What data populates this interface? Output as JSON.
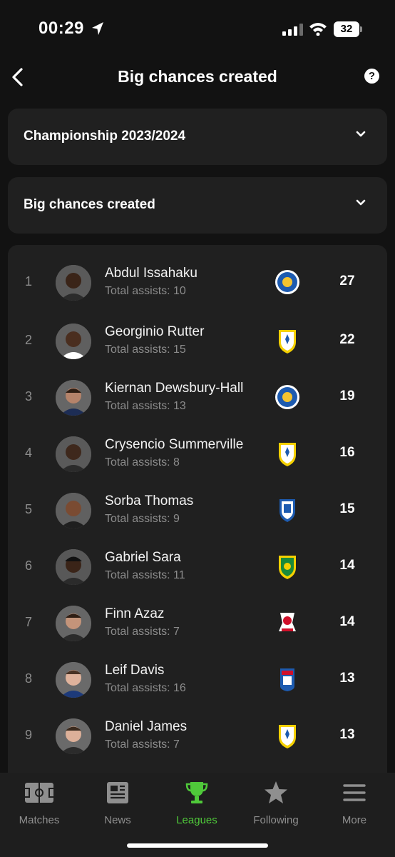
{
  "status_bar": {
    "time": "00:29",
    "battery": "32"
  },
  "header": {
    "title": "Big chances created",
    "help_label": "?"
  },
  "filters": {
    "season": "Championship 2023/2024",
    "stat": "Big chances created"
  },
  "players": [
    {
      "rank": "1",
      "name": "Abdul Issahaku",
      "assists": "Total assists: 10",
      "value": "27",
      "club": "leicester-crest-icon"
    },
    {
      "rank": "2",
      "name": "Georginio Rutter",
      "assists": "Total assists: 15",
      "value": "22",
      "club": "leeds-crest-icon"
    },
    {
      "rank": "3",
      "name": "Kiernan Dewsbury-Hall",
      "assists": "Total assists: 13",
      "value": "19",
      "club": "leicester-crest-icon"
    },
    {
      "rank": "4",
      "name": "Crysencio Summerville",
      "assists": "Total assists: 8",
      "value": "16",
      "club": "leeds-crest-icon"
    },
    {
      "rank": "5",
      "name": "Sorba Thomas",
      "assists": "Total assists: 9",
      "value": "15",
      "club": "huddersfield-crest-icon"
    },
    {
      "rank": "6",
      "name": "Gabriel Sara",
      "assists": "Total assists: 11",
      "value": "14",
      "club": "norwich-crest-icon"
    },
    {
      "rank": "7",
      "name": "Finn Azaz",
      "assists": "Total assists: 7",
      "value": "14",
      "club": "middlesbrough-crest-icon"
    },
    {
      "rank": "8",
      "name": "Leif Davis",
      "assists": "Total assists: 16",
      "value": "13",
      "club": "ipswich-crest-icon"
    },
    {
      "rank": "9",
      "name": "Daniel James",
      "assists": "Total assists: 7",
      "value": "13",
      "club": "leeds-crest-icon"
    }
  ],
  "tabs": [
    {
      "label": "Matches",
      "icon": "pitch-icon",
      "active": false
    },
    {
      "label": "News",
      "icon": "newspaper-icon",
      "active": false
    },
    {
      "label": "Leagues",
      "icon": "trophy-icon",
      "active": true
    },
    {
      "label": "Following",
      "icon": "star-icon",
      "active": false
    },
    {
      "label": "More",
      "icon": "menu-icon",
      "active": false
    }
  ],
  "colors": {
    "background": "#121212",
    "card": "#202020",
    "accent": "#4fc93a",
    "muted": "#8c8c8c"
  }
}
